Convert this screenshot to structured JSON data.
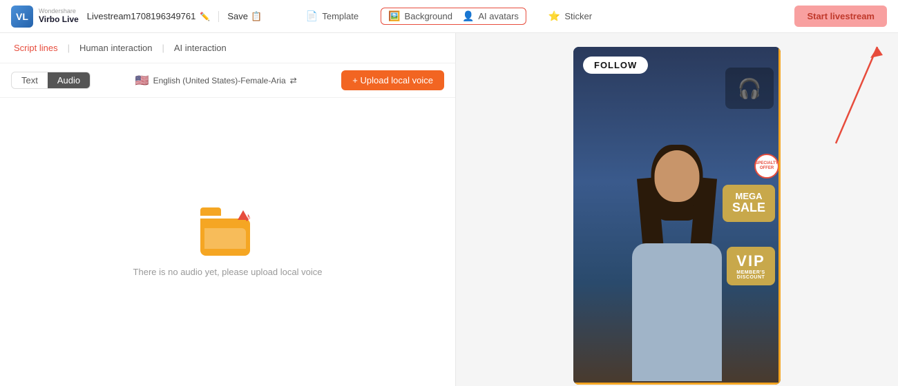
{
  "app": {
    "logo_top": "Wondershare",
    "logo_bottom": "Virbo Live"
  },
  "header": {
    "stream_title": "Livestream1708196349761",
    "save_label": "Save",
    "template_label": "Template",
    "background_label": "Background",
    "ai_avatars_label": "AI avatars",
    "sticker_label": "Sticker",
    "start_livestream_label": "Start livestream"
  },
  "left_panel": {
    "tab_script_lines": "Script lines",
    "tab_human_interaction": "Human interaction",
    "tab_ai_interaction": "AI interaction",
    "text_toggle": "Text",
    "audio_toggle": "Audio",
    "language_label": "English (United States)-Female-Aria",
    "upload_voice_label": "+ Upload local voice",
    "empty_text": "There is no audio yet, please upload local voice"
  },
  "preview": {
    "follow_badge": "FOLLOW",
    "mega_sale_line1": "MEGA",
    "mega_sale_line2": "SALE",
    "vip_text": "VIP",
    "member_text": "MEMBER'S",
    "discount_text": "DISCOUNT",
    "special_badge": "SPECIALTY\nOFFER"
  }
}
